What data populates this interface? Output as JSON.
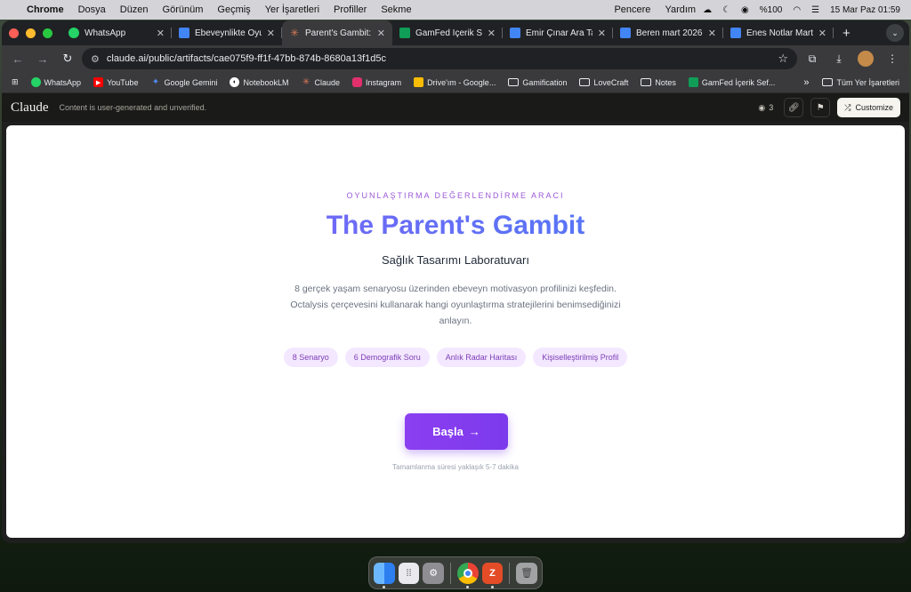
{
  "menubar": {
    "app": "Chrome",
    "items": [
      "Dosya",
      "Düzen",
      "Görünüm",
      "Geçmiş",
      "Yer İşaretleri",
      "Profiller",
      "Sekme"
    ],
    "right_items": [
      "Pencere",
      "Yardım"
    ],
    "battery": "%100",
    "datetime": "15 Mar Paz  01:59"
  },
  "tabs": [
    {
      "title": "WhatsApp",
      "icon": "whatsapp-icon",
      "color": "#25d366"
    },
    {
      "title": "Ebeveynlikte Oyunl",
      "icon": "docs-icon",
      "color": "#4285f4"
    },
    {
      "title": "Parent's Gambit: G",
      "icon": "claude-icon",
      "color": "#d97757",
      "active": true
    },
    {
      "title": "GamFed İçerik Sefe",
      "icon": "sheets-icon",
      "color": "#0f9d58"
    },
    {
      "title": "Emir Çınar Ara Tatil",
      "icon": "docs-icon",
      "color": "#4285f4"
    },
    {
      "title": "Beren mart 2026 -",
      "icon": "docs-icon",
      "color": "#4285f4"
    },
    {
      "title": "Enes Notlar Mart 2(",
      "icon": "docs-icon",
      "color": "#4285f4"
    }
  ],
  "omnibox": {
    "url": "claude.ai/public/artifacts/cae075f9-ff1f-47bb-874b-8680a13f1d5c"
  },
  "bookmarks": [
    {
      "label": "WhatsApp",
      "icon": "whatsapp-icon",
      "color": "#25d366"
    },
    {
      "label": "YouTube",
      "icon": "youtube-icon",
      "color": "#ff0000"
    },
    {
      "label": "Google Gemini",
      "icon": "gemini-icon",
      "color": "#4f8bf9"
    },
    {
      "label": "NotebookLM",
      "icon": "notebooklm-icon",
      "color": "#ffffff"
    },
    {
      "label": "Claude",
      "icon": "claude-icon",
      "color": "#d97757"
    },
    {
      "label": "Instagram",
      "icon": "instagram-icon",
      "color": "#e1306c"
    },
    {
      "label": "Drive'ım - Google...",
      "icon": "drive-icon",
      "color": "#fbbc04"
    },
    {
      "label": "Gamification",
      "icon": "folder-icon"
    },
    {
      "label": "LoveCraft",
      "icon": "folder-icon"
    },
    {
      "label": "Notes",
      "icon": "folder-icon"
    },
    {
      "label": "GamFed İçerik Sef...",
      "icon": "sheets-icon",
      "color": "#0f9d58"
    }
  ],
  "bookmarks_all": "Tüm Yer İşaretleri",
  "claude_bar": {
    "logo": "Claude",
    "notice": "Content is user-generated and unverified.",
    "views": "3",
    "customize": "Customize"
  },
  "artifact": {
    "eyebrow": "OYUNLAŞTIRMA DEĞERLENDİRME ARACI",
    "title": "The Parent's Gambit",
    "subtitle": "Sağlık Tasarımı Laboratuvarı",
    "description": "8 gerçek yaşam senaryosu üzerinden ebeveyn motivasyon profilinizi keşfedin. Octalysis çerçevesini kullanarak hangi oyunlaştırma stratejilerini benimsediğinizi anlayın.",
    "chips": [
      "8 Senaryo",
      "6 Demografik Soru",
      "Anlık Radar Haritası",
      "Kişiselleştirilmiş Profil"
    ],
    "start_button": "Başla",
    "duration": "Tamamlanma süresi yaklaşık 5-7 dakika"
  },
  "colors": {
    "accent": "#7c3aed",
    "title_gradient_start": "#8b5cf6",
    "title_gradient_end": "#3b82f6",
    "chip_bg": "#f3e8ff"
  },
  "dock": [
    "finder-icon",
    "launchpad-icon",
    "system-settings-icon",
    "chrome-icon",
    "app-icon",
    "trash-icon"
  ]
}
